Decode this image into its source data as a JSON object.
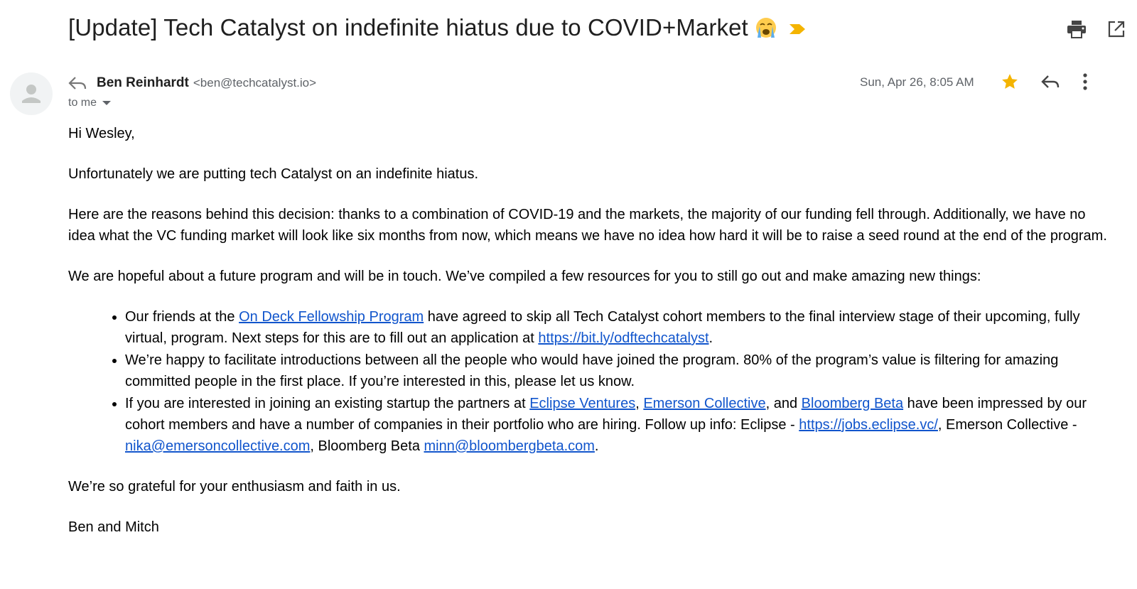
{
  "subject": "[Update] Tech Catalyst on indefinite hiatus due to COVID+Market",
  "sender": {
    "name": "Ben Reinhardt",
    "email": "<ben@techcatalyst.io>"
  },
  "recipient": "to me",
  "date": "Sun, Apr 26, 8:05 AM",
  "icons": {
    "subject_emoji": "loudly-crying-face-icon",
    "important": "important-marker-icon",
    "print": "print-icon",
    "open_new_window": "open-in-new-window-icon",
    "star": "star-icon",
    "reply": "reply-icon",
    "more": "more-vert-icon",
    "avatar": "default-avatar-icon"
  },
  "colors": {
    "link": "#1155cc",
    "star": "#f4b400",
    "important": "#f4b400"
  },
  "body": {
    "greeting": "Hi Wesley,",
    "p1": "Unfortunately we are putting tech Catalyst on an indefinite hiatus.",
    "p2": "Here are the reasons behind this decision: thanks to a combination of COVID-19 and the markets, the majority of our funding fell through. Additionally, we have no idea what the VC funding market will look like six months from now, which means we have no idea how hard it will be to raise a seed round at the end of the program.",
    "p3": "We are hopeful about a future program and will be in touch. We’ve compiled a few resources for you to still go out and make amazing new things:",
    "bullet1": {
      "pre": "Our friends at the ",
      "link1": "On Deck Fellowship Program",
      "mid": " have agreed to skip all Tech Catalyst cohort members to the final interview stage of their upcoming, fully virtual, program. Next steps for this are to fill out an application at ",
      "link2": "https://bit.ly/odftechcatalyst",
      "post": "."
    },
    "bullet2": "We’re happy to facilitate introductions between all the people who would have joined the program. 80% of the program’s value is filtering for amazing committed people in the first place. If you’re interested in this, please let us know.",
    "bullet3": {
      "pre": "If you are interested in joining an existing startup the partners at ",
      "link_eclipse": "Eclipse Ventures",
      "sep1": ", ",
      "link_emerson": "Emerson Collective",
      "sep2": ", and ",
      "link_bloomberg": "Bloomberg Beta",
      "mid": " have been impressed by our cohort members and have a number of companies in their portfolio who are hiring. Follow up info: Eclipse - ",
      "link_jobs": "https://jobs.eclipse.vc/",
      "mid2": ", Emerson Collective - ",
      "link_nika": "nika@emersoncollective.com",
      "mid3": ", Bloomberg Beta ",
      "link_minn": "minn@bloombergbeta.com",
      "post": "."
    },
    "p4": "We’re so grateful for your enthusiasm and faith in us.",
    "signoff": "Ben and Mitch"
  }
}
